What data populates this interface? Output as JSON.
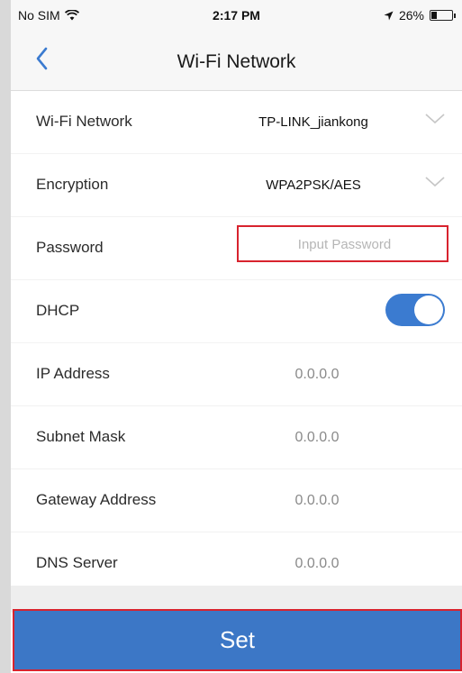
{
  "status_bar": {
    "carrier": "No SIM",
    "time": "2:17 PM",
    "battery": "26%",
    "battery_level": 0.26,
    "icons": [
      "wifi-icon",
      "location-arrow-icon",
      "battery-icon"
    ]
  },
  "nav": {
    "title": "Wi-Fi Network",
    "back_icon": "chevron-left-icon"
  },
  "rows": {
    "wifi": {
      "label": "Wi-Fi Network",
      "value": "TP-LINK_jiankong"
    },
    "encryption": {
      "label": "Encryption",
      "value": "WPA2PSK/AES"
    },
    "password": {
      "label": "Password",
      "value": "",
      "placeholder": "Input Password"
    },
    "dhcp": {
      "label": "DHCP",
      "enabled": true
    },
    "ip": {
      "label": "IP Address",
      "value": "0.0.0.0"
    },
    "subnet": {
      "label": "Subnet Mask",
      "value": "0.0.0.0"
    },
    "gateway": {
      "label": "Gateway Address",
      "value": "0.0.0.0"
    },
    "dns": {
      "label": "DNS Server",
      "value": "0.0.0.0"
    }
  },
  "set_button": {
    "label": "Set"
  },
  "colors": {
    "accent": "#3c77c6",
    "toggle_on": "#3b7bd0",
    "highlight_border": "#d8232e",
    "background": "#f7f7f7"
  }
}
